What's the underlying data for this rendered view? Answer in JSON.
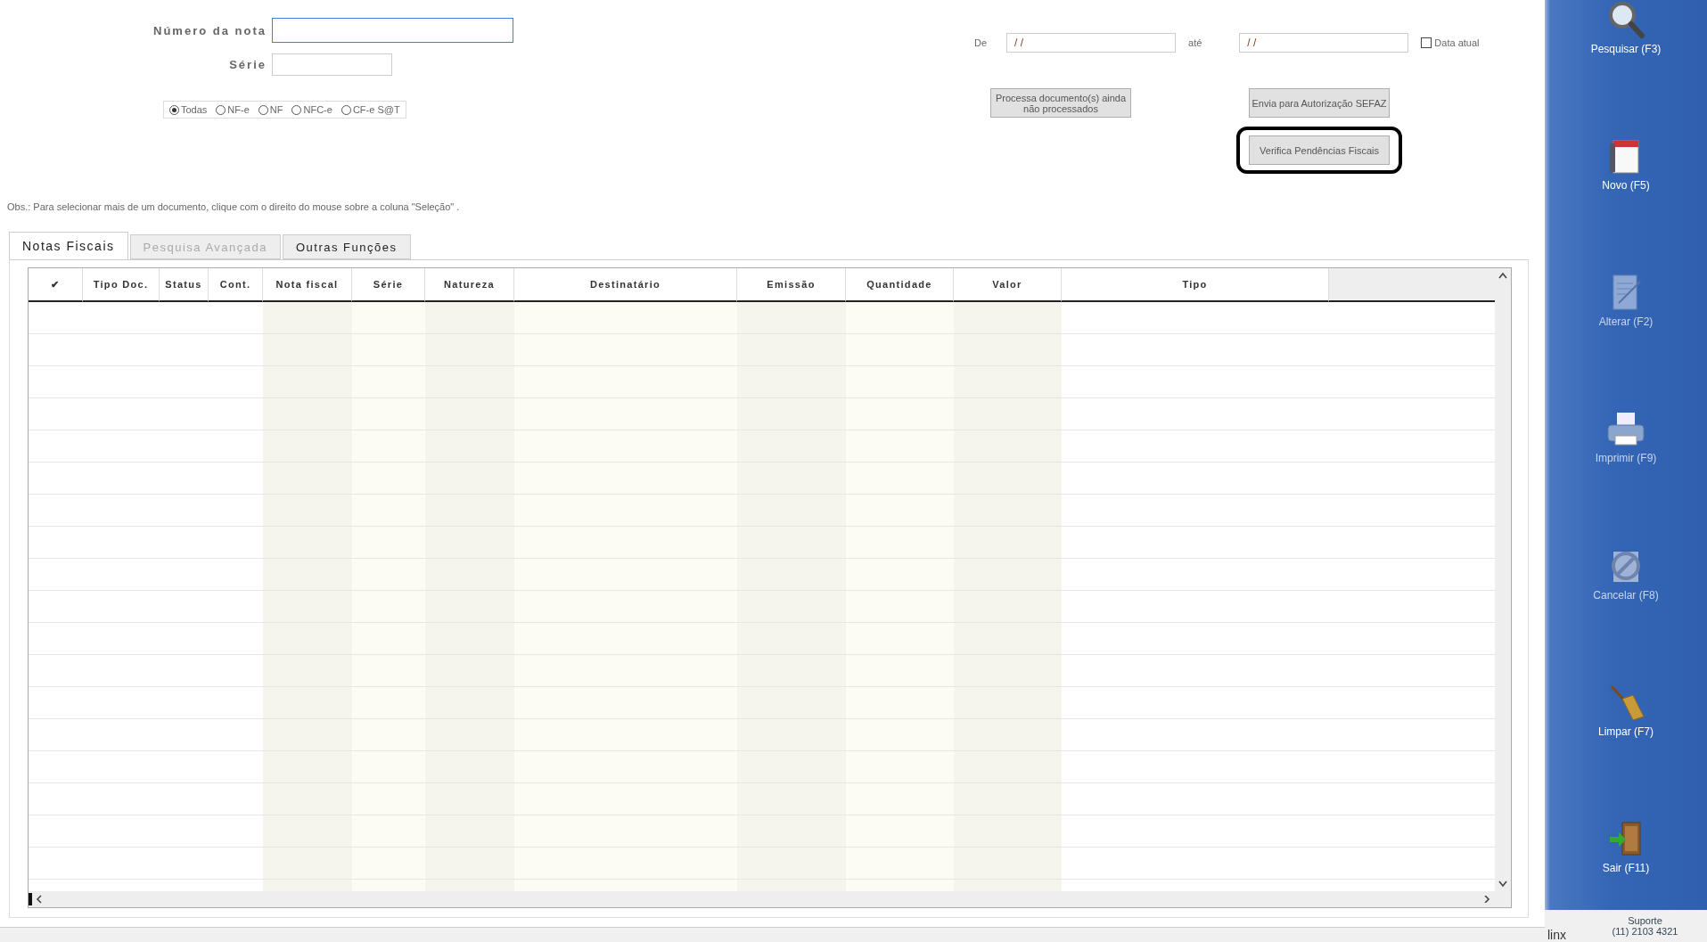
{
  "search_form": {
    "numero_label": "Número da nota",
    "serie_label": "Série",
    "doc_types": [
      {
        "label": "Todas",
        "selected": true
      },
      {
        "label": "NF-e",
        "selected": false
      },
      {
        "label": "NF",
        "selected": false
      },
      {
        "label": "NFC-e",
        "selected": false
      },
      {
        "label": "CF-e S@T",
        "selected": false
      }
    ],
    "date_from_label": "De",
    "date_from_value": "/ /",
    "date_to_label": "até",
    "date_to_value": "/ /",
    "current_date": {
      "label": "Data atual",
      "checked": false
    }
  },
  "actions": [
    {
      "label": "Processa documento(s) ainda não processados",
      "outlined": false
    },
    {
      "label": "Envia para Autorização SEFAZ",
      "outlined": false
    },
    {
      "label": "Verifica Pendências Fiscais",
      "outlined": true
    }
  ],
  "note": "Obs.: Para selecionar mais de um documento, clique com o direito do mouse sobre a coluna \"Seleção\" .",
  "tabs": [
    {
      "label": "Notas Fiscais",
      "selected": true,
      "disabled": false
    },
    {
      "label": "Pesquisa Avançada",
      "selected": false,
      "disabled": true
    },
    {
      "label": "Outras Funções",
      "selected": false,
      "disabled": false
    }
  ],
  "table": {
    "columns": [
      "✔",
      "Tipo Doc.",
      "Status",
      "Cont.",
      "Nota fiscal",
      "Série",
      "Natureza",
      "Destinatário",
      "Emissão",
      "Quantidade",
      "Valor",
      "Tipo"
    ]
  },
  "toolbar": [
    {
      "label": "Pesquisar (F3)",
      "kind": "search",
      "disabled": false
    },
    {
      "label": "Novo (F5)",
      "kind": "new",
      "disabled": false
    },
    {
      "label": "Alterar (F2)",
      "kind": "edit",
      "disabled": true
    },
    {
      "label": "Imprimir (F9)",
      "kind": "print",
      "disabled": true
    },
    {
      "label": "Cancelar (F8)",
      "kind": "cancel",
      "disabled": true
    },
    {
      "label": "Limpar (F7)",
      "kind": "clear",
      "disabled": false
    },
    {
      "label": "Sair (F11)",
      "kind": "exit",
      "disabled": false
    }
  ],
  "support": {
    "logo": "linx",
    "title": "Suporte",
    "phone": "(11) 2103 4321"
  }
}
